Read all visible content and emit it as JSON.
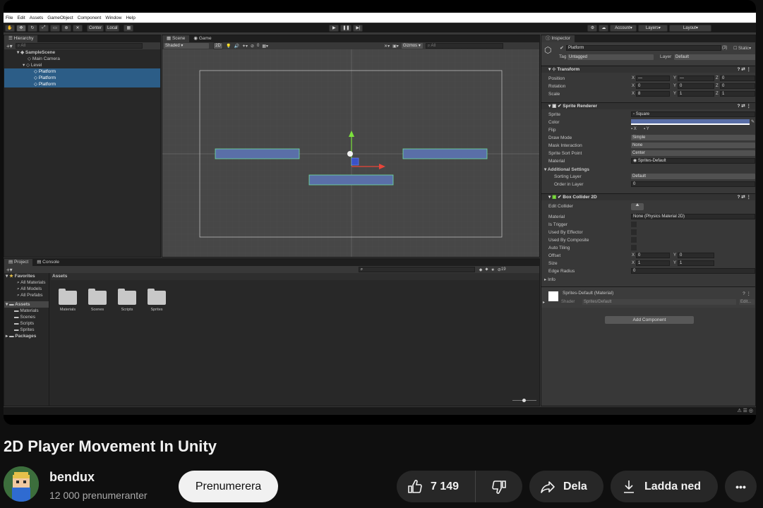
{
  "menu": [
    "File",
    "Edit",
    "Assets",
    "GameObject",
    "Component",
    "Window",
    "Help"
  ],
  "toolbar": {
    "pivot": "Center",
    "space": "Local",
    "account": "Account",
    "layers": "Layers",
    "layout": "Layout"
  },
  "hierarchy": {
    "tab": "Hierarchy",
    "search": "All",
    "rows": [
      "SampleScene",
      "Main Camera",
      "Level",
      "Platform",
      "Platform",
      "Platform"
    ]
  },
  "scene": {
    "tabs": [
      "Scene",
      "Game"
    ],
    "shading": "Shaded",
    "mode2d": "2D",
    "gizmos": "Gizmos",
    "gizmo_count": "0",
    "search": "All"
  },
  "project": {
    "tabs": [
      "Project",
      "Console"
    ],
    "count": "19",
    "tree": [
      "Favorites",
      "All Materials",
      "All Models",
      "All Prefabs",
      "Assets",
      "Materials",
      "Scenes",
      "Scripts",
      "Sprites",
      "Packages"
    ],
    "breadcrumb": "Assets",
    "folders": [
      "Materials",
      "Scenes",
      "Scripts",
      "Sprites"
    ]
  },
  "inspector": {
    "tab": "Inspector",
    "name": "Platform",
    "count": "(3)",
    "static": "Static",
    "tag_label": "Tag",
    "tag": "Untagged",
    "layer_label": "Layer",
    "layer": "Default",
    "transform": {
      "title": "Transform",
      "rows": [
        {
          "label": "Position",
          "x": "—",
          "y": "—",
          "z": "0"
        },
        {
          "label": "Rotation",
          "x": "0",
          "y": "0",
          "z": "0"
        },
        {
          "label": "Scale",
          "x": "8",
          "y": "1",
          "z": "1"
        }
      ]
    },
    "sprite_renderer": {
      "title": "Sprite Renderer",
      "sprite_label": "Sprite",
      "sprite": "Square",
      "color_label": "Color",
      "color": "#5a6fa8",
      "flip_label": "Flip",
      "flip_x": "X",
      "flip_y": "Y",
      "draw_mode_label": "Draw Mode",
      "draw_mode": "Simple",
      "mask_label": "Mask Interaction",
      "mask": "None",
      "sort_point_label": "Sprite Sort Point",
      "sort_point": "Center",
      "material_label": "Material",
      "material": "Sprites-Default",
      "additional": "Additional Settings",
      "sorting_layer_label": "Sorting Layer",
      "sorting_layer": "Default",
      "order_label": "Order in Layer",
      "order": "0"
    },
    "box_collider": {
      "title": "Box Collider 2D",
      "edit_label": "Edit Collider",
      "material_label": "Material",
      "material": "None (Physics Material 2D)",
      "trigger_label": "Is Trigger",
      "effector_label": "Used By Effector",
      "composite_label": "Used By Composite",
      "tiling_label": "Auto Tiling",
      "offset_label": "Offset",
      "offset_x": "0",
      "offset_y": "0",
      "size_label": "Size",
      "size_x": "1",
      "size_y": "1",
      "edge_label": "Edge Radius",
      "edge": "0",
      "info": "Info"
    },
    "material_block": {
      "name": "Sprites-Default (Material)",
      "shader_label": "Shader",
      "shader": "Sprites/Default",
      "edit": "Edit..."
    },
    "add_component": "Add Component"
  },
  "youtube": {
    "title": "2D Player Movement In Unity",
    "channel": "bendux",
    "subscribers": "12 000 prenumeranter",
    "subscribe": "Prenumerera",
    "likes": "7 149",
    "share": "Dela",
    "download": "Ladda ned",
    "more": "•••"
  }
}
